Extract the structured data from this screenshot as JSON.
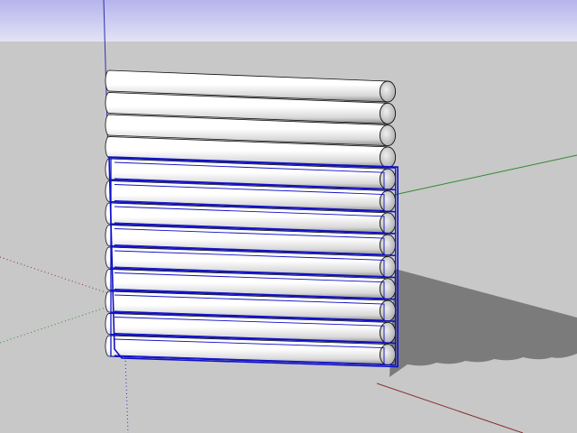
{
  "scene": {
    "sky_top_color": "#b4b4ec",
    "sky_bottom_color": "#e2e2f6",
    "ground_color": "#c8c8c8",
    "log_color": "#ffffff",
    "log_shadow_color": "#9a9a9a",
    "selection_color": "#1010c8",
    "shadow_color": "#7b7b7b",
    "axis_red_color": "#8a3030",
    "axis_green_color": "#2f8a2f",
    "axis_blue_color": "#3030b0",
    "unselected_log_count": 4,
    "selected_log_count": 9
  }
}
